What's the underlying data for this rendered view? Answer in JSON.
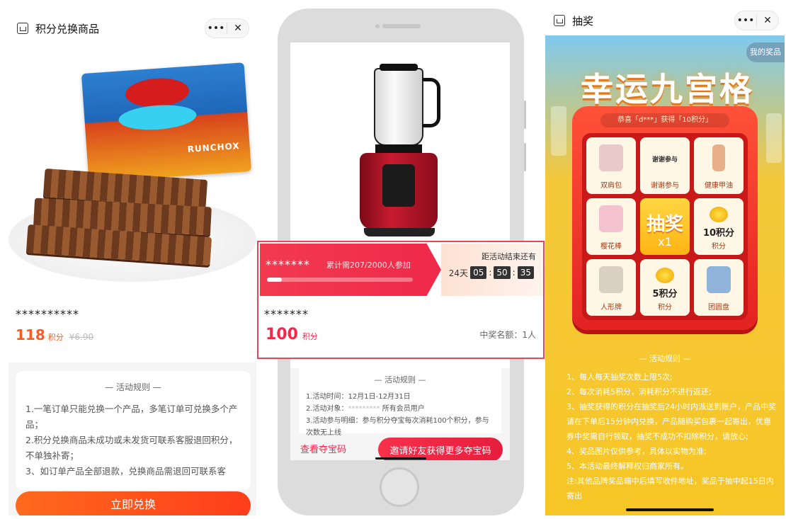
{
  "screen1": {
    "title": "积分兑换商品",
    "capsule": {
      "more": "•••",
      "close": "✕"
    },
    "product": {
      "brand_text": "RUNCHOX",
      "name": "**********",
      "price": "118",
      "price_unit": "积分",
      "original_price": "¥6.90"
    },
    "rules": {
      "title": "— 活动规则 —",
      "lines": [
        "1.一笔订单只能兑换一个产品，多笔订单可兑换多个产品；",
        "2.积分兑换商品未成功或未发货可联系客服退回积分，不单独补寄；",
        "3、如订单产品全部退款，兑换商品需退回可联系客"
      ]
    },
    "cta": "立即兑换"
  },
  "screen2": {
    "progress": {
      "masked_name": "*******",
      "count_text": "累计需207/2000人参加",
      "joined": 207,
      "required": 2000
    },
    "countdown": {
      "label": "距活动结束还有",
      "days": "24天",
      "hh": "05",
      "mm": "50",
      "ss": "35"
    },
    "product": {
      "name": "*******",
      "price": "100",
      "price_unit": "积分",
      "winners": "中奖名额：1人"
    },
    "rules": {
      "title": "— 活动规则 —",
      "line1": "1.活动时间：12月1日-12月31日",
      "line2_prefix": "2.活动对象：",
      "line2_mask": "*********",
      "line2_suffix": "所有会员用户",
      "line3": "3.活动参与明细：参与积分夺宝每次消耗100个积分，参与次数无上线"
    },
    "view_codes": "查看夺宝码",
    "invite": "邀请好友获得更多夺宝码"
  },
  "screen3": {
    "title": "抽奖",
    "capsule": {
      "more": "•••",
      "close": "✕"
    },
    "my_prizes": "我的奖品",
    "banner_title": "幸运九宫格",
    "marquee": "恭喜「d***」获得「10积分」",
    "cells": [
      {
        "label": "双肩包",
        "color": "#e9c9c9"
      },
      {
        "label": "谢谢参与",
        "top_text": "谢谢参与"
      },
      {
        "label": "健康甲油",
        "color": "#e7b08a"
      },
      {
        "label": "樱花棒",
        "color": "#f5c2cf"
      },
      {
        "label": "10积分",
        "sub": "积分"
      },
      {
        "label": "人形牌",
        "color": "#d9d0c2"
      },
      {
        "label": "5积分",
        "sub": "积分"
      },
      {
        "label": "团圆盘",
        "color": "#8fb3d9"
      }
    ],
    "center": {
      "t1": "抽奖",
      "t2": "x1"
    },
    "rules_title": "— 活动规则 —",
    "rules": [
      "1、每人每天抽奖次数上限5次;",
      "2、每次消耗5积分，消耗积分不进行返还;",
      "3、抽奖获得的积分在抽奖后24小时内派送到账户，产品中奖请在下单后15分钟内兑换，产品随购买包裹一起寄出，优惠券中奖需自行领取，抽奖不成功不扣除积分，请放心;",
      "4、奖品图片仅供参考，具体以实物为准;",
      "5、本活动最终解释权归商家所有。",
      "注:其他品牌奖品端中后填写收件地址，奖品于抽中起15日内寄出"
    ]
  }
}
